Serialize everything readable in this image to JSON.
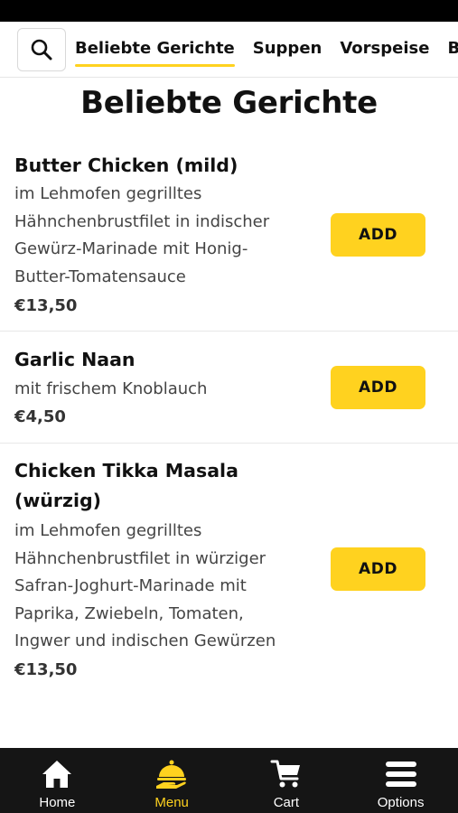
{
  "categories": {
    "tabs": [
      {
        "label": "Beliebte Gerichte",
        "active": true
      },
      {
        "label": "Suppen"
      },
      {
        "label": "Vorspeise"
      },
      {
        "label": "Be"
      }
    ]
  },
  "page_title": "Beliebte Gerichte",
  "items": [
    {
      "name": "Butter Chicken (mild)",
      "description_lines": [
        "im Lehmofen gegrilltes",
        "Hähnchenbrustfilet in indischer",
        "Gewürz-Marinade mit Honig-",
        "Butter-Tomatensauce"
      ],
      "price": "€13,50",
      "add_label": "ADD"
    },
    {
      "name": "Garlic Naan",
      "description_lines": [
        "mit frischem Knoblauch"
      ],
      "price": "€4,50",
      "add_label": "ADD"
    },
    {
      "name_lines": [
        "Chicken Tikka Masala",
        "(würzig)"
      ],
      "description_lines": [
        "im Lehmofen gegrilltes",
        "Hähnchenbrustfilet in würziger",
        "Safran-Joghurt-Marinade mit",
        "Paprika, Zwiebeln, Tomaten,",
        "Ingwer und indischen Gewürzen"
      ],
      "price": "€13,50",
      "add_label": "ADD"
    }
  ],
  "bottom_nav": [
    {
      "label": "Home",
      "icon": "home-icon"
    },
    {
      "label": "Menu",
      "icon": "menu-cloche-icon",
      "active": true
    },
    {
      "label": "Cart",
      "icon": "cart-icon"
    },
    {
      "label": "Options",
      "icon": "options-icon"
    }
  ],
  "colors": {
    "accent": "#ffd21f",
    "nav_bg": "#151515"
  }
}
